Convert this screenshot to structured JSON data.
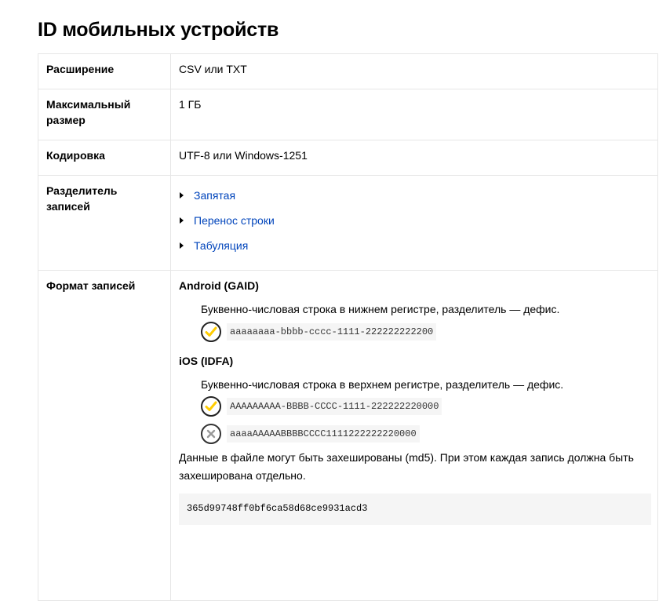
{
  "page": {
    "title": "ID мобильных устройств"
  },
  "table": {
    "extension": {
      "label": "Расширение",
      "value": "CSV или TXT"
    },
    "max_size": {
      "label_line1": "Максимальный",
      "label_line2": "размер",
      "value": "1 ГБ"
    },
    "encoding": {
      "label": "Кодировка",
      "value": "UTF-8 или Windows-1251"
    },
    "separator": {
      "label_line1": "Разделитель",
      "label_line2": "записей",
      "options": [
        {
          "label": "Запятая"
        },
        {
          "label": "Перенос строки"
        },
        {
          "label": "Табуляция"
        }
      ]
    },
    "format": {
      "label": "Формат записей",
      "android": {
        "title": "Android (GAID)",
        "description": "Буквенно-числовая строка в нижнем регистре, разделитель — дефис.",
        "valid_example": "aaaaaaaa-bbbb-cccc-1111-222222222200"
      },
      "ios": {
        "title": "iOS (IDFA)",
        "description": "Буквенно-числовая строка в верхнем регистре, разделитель — дефис.",
        "valid_example": "AAAAAAAAA-BBBB-CCCC-1111-222222220000",
        "invalid_example": "aaaaAAAAABBBBCCCC1111222222220000"
      },
      "hash_note_line1": "Данные в файле могут быть захешированы (md5). При этом каждая запись должна быть",
      "hash_note_line2": "захеширована отдельно.",
      "hash_example": "365d99748ff0bf6ca58d68ce9931acd3"
    }
  },
  "colors": {
    "link": "#0044bb",
    "check": "#ffcc00",
    "cross": "#999999",
    "border": "#e6e6e6"
  }
}
